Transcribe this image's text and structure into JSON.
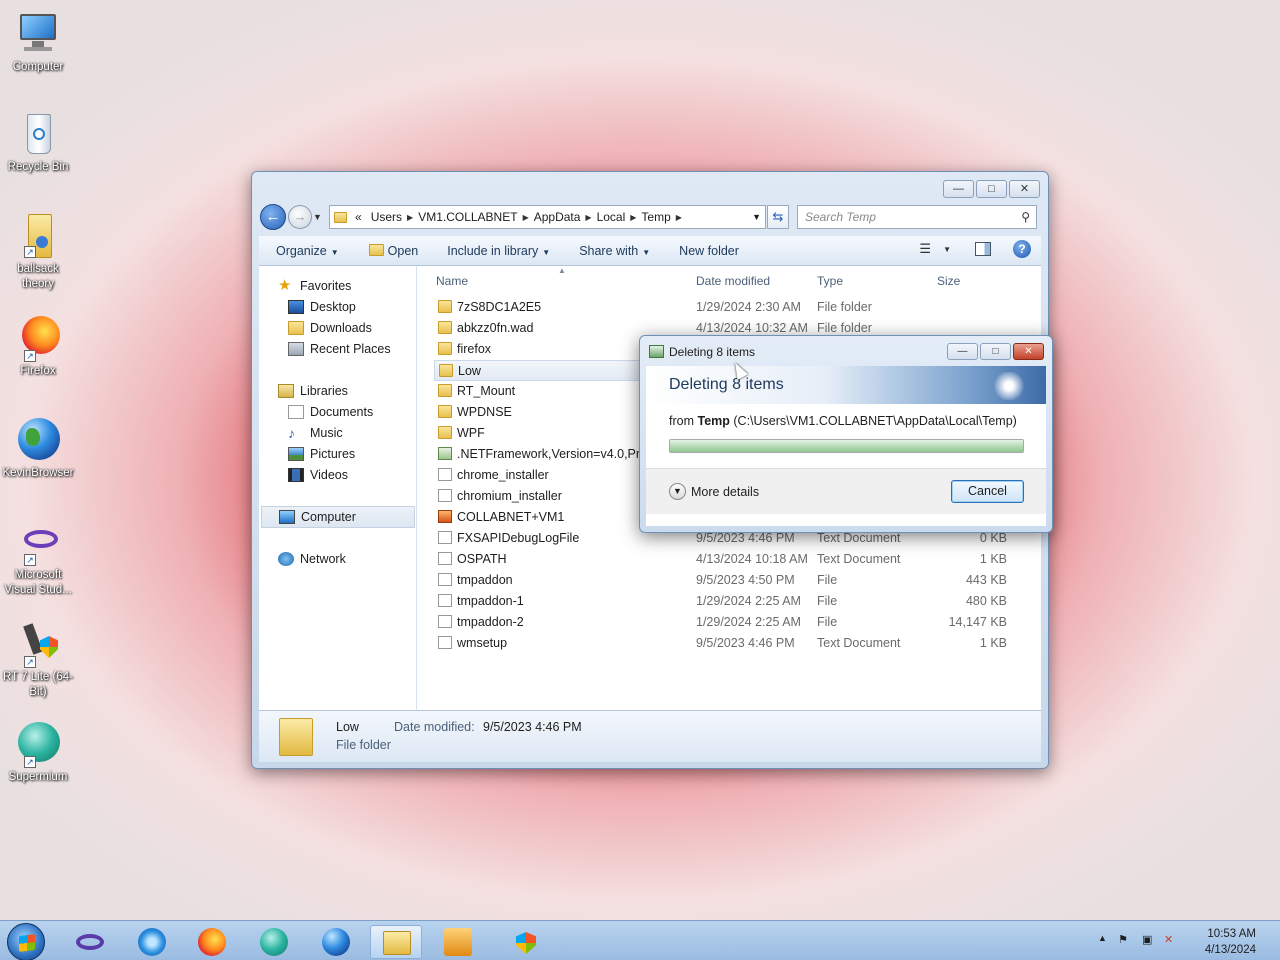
{
  "desktop": {
    "icons": [
      {
        "label": "Computer"
      },
      {
        "label": "Recycle Bin"
      },
      {
        "label": "ballsack theory"
      },
      {
        "label": "Firefox"
      },
      {
        "label": "KevinBrowser"
      },
      {
        "label": "Microsoft Visual Stud..."
      },
      {
        "label": "RT 7 Lite (64-Bit)"
      },
      {
        "label": "Supermium"
      }
    ]
  },
  "explorer": {
    "controls": {
      "minimize": "—",
      "maximize": "□",
      "close": "✕"
    },
    "breadcrumb": {
      "overflow": "«",
      "items": [
        "Users",
        "VM1.COLLABNET",
        "AppData",
        "Local",
        "Temp"
      ]
    },
    "search": {
      "placeholder": "Search Temp"
    },
    "toolbar": {
      "organize": "Organize",
      "open": "Open",
      "include_in_library": "Include in library",
      "share_with": "Share with",
      "new_folder": "New folder",
      "help": "?"
    },
    "nav": {
      "favorites": "Favorites",
      "desktop": "Desktop",
      "downloads": "Downloads",
      "recent_places": "Recent Places",
      "libraries": "Libraries",
      "documents": "Documents",
      "music": "Music",
      "pictures": "Pictures",
      "videos": "Videos",
      "computer": "Computer",
      "network": "Network"
    },
    "columns": {
      "name": "Name",
      "date_modified": "Date modified",
      "type": "Type",
      "size": "Size"
    },
    "files": [
      {
        "name": "7zS8DC1A2E5",
        "date": "1/29/2024 2:30 AM",
        "type": "File folder",
        "size": "",
        "icon": "folder"
      },
      {
        "name": "abkzz0fn.wad",
        "date": "4/13/2024 10:32 AM",
        "type": "File folder",
        "size": "",
        "icon": "folder"
      },
      {
        "name": "firefox",
        "date": "",
        "type": "",
        "size": "",
        "icon": "folder"
      },
      {
        "name": "Low",
        "date": "",
        "type": "",
        "size": "",
        "icon": "folder"
      },
      {
        "name": "RT_Mount",
        "date": "",
        "type": "",
        "size": "",
        "icon": "folder"
      },
      {
        "name": "WPDNSE",
        "date": "",
        "type": "",
        "size": "",
        "icon": "folder"
      },
      {
        "name": "WPF",
        "date": "",
        "type": "",
        "size": "",
        "icon": "folder"
      },
      {
        "name": ".NETFramework,Version=v4.0,Profi",
        "date": "",
        "type": "",
        "size": "",
        "icon": "config"
      },
      {
        "name": "chrome_installer",
        "date": "",
        "type": "",
        "size": "",
        "icon": "file"
      },
      {
        "name": "chromium_installer",
        "date": "",
        "type": "",
        "size": "",
        "icon": "file"
      },
      {
        "name": "COLLABNET+VM1",
        "date": "",
        "type": "",
        "size": "",
        "icon": "xml"
      },
      {
        "name": "FXSAPIDebugLogFile",
        "date": "9/5/2023 4:46 PM",
        "type": "Text Document",
        "size": "0 KB",
        "icon": "file"
      },
      {
        "name": "OSPATH",
        "date": "4/13/2024 10:18 AM",
        "type": "Text Document",
        "size": "1 KB",
        "icon": "file"
      },
      {
        "name": "tmpaddon",
        "date": "9/5/2023 4:50 PM",
        "type": "File",
        "size": "443 KB",
        "icon": "file"
      },
      {
        "name": "tmpaddon-1",
        "date": "1/29/2024 2:25 AM",
        "type": "File",
        "size": "480 KB",
        "icon": "file"
      },
      {
        "name": "tmpaddon-2",
        "date": "1/29/2024 2:25 AM",
        "type": "File",
        "size": "14,147 KB",
        "icon": "file"
      },
      {
        "name": "wmsetup",
        "date": "9/5/2023 4:46 PM",
        "type": "Text Document",
        "size": "1 KB",
        "icon": "file"
      }
    ],
    "selected_index": 3,
    "details": {
      "name": "Low",
      "kind": "File folder",
      "date_label": "Date modified:",
      "date_value": "9/5/2023 4:46 PM"
    }
  },
  "dialog": {
    "title": "Deleting 8 items",
    "heading": "Deleting 8 items",
    "from_prefix": "from",
    "from_folder": "Temp",
    "from_path": "(C:\\Users\\VM1.COLLABNET\\AppData\\Local\\Temp)",
    "progress_fraction": 1.0,
    "more_details": "More details",
    "cancel": "Cancel",
    "controls": {
      "minimize": "—",
      "maximize": "□",
      "close": "✕"
    }
  },
  "taskbar": {
    "clock_time": "10:53 AM",
    "clock_date": "4/13/2024"
  },
  "colors": {
    "accent": "#2a62b8",
    "close_red": "#c4412b",
    "progress_green": "#92c792"
  }
}
